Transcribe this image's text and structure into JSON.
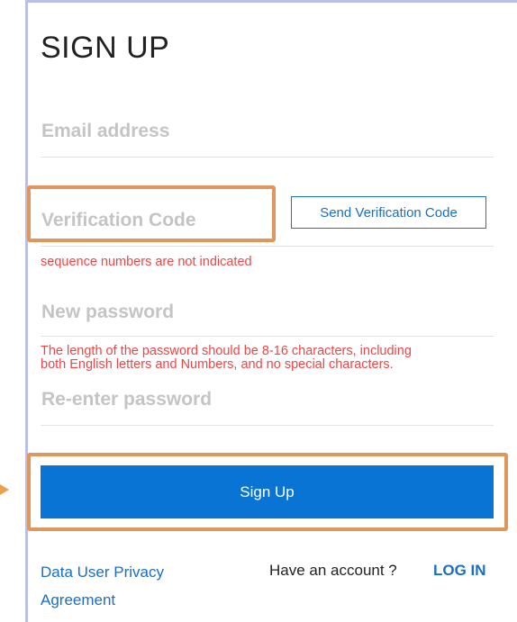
{
  "form": {
    "title": "SIGN UP",
    "email_placeholder": "Email address",
    "code_placeholder": "Verification Code",
    "send_code_label": "Send Verification Code",
    "code_error": "sequence numbers are not indicated",
    "password_placeholder": "New password",
    "password_error_line1": "The length of the password should be 8-16 characters, including",
    "password_error_line2": "both English letters and Numbers, and no special characters.",
    "reenter_placeholder": "Re-enter password",
    "submit_label": "Sign Up"
  },
  "footer": {
    "privacy_line1": "Data User Privacy",
    "privacy_line2": "Agreement",
    "have_account": "Have an account ?",
    "login_label": "LOG IN"
  },
  "colors": {
    "accent": "#0a74d4",
    "error": "#ee4646",
    "highlight": "#e0975c",
    "placeholder": "#c4c4c4"
  }
}
